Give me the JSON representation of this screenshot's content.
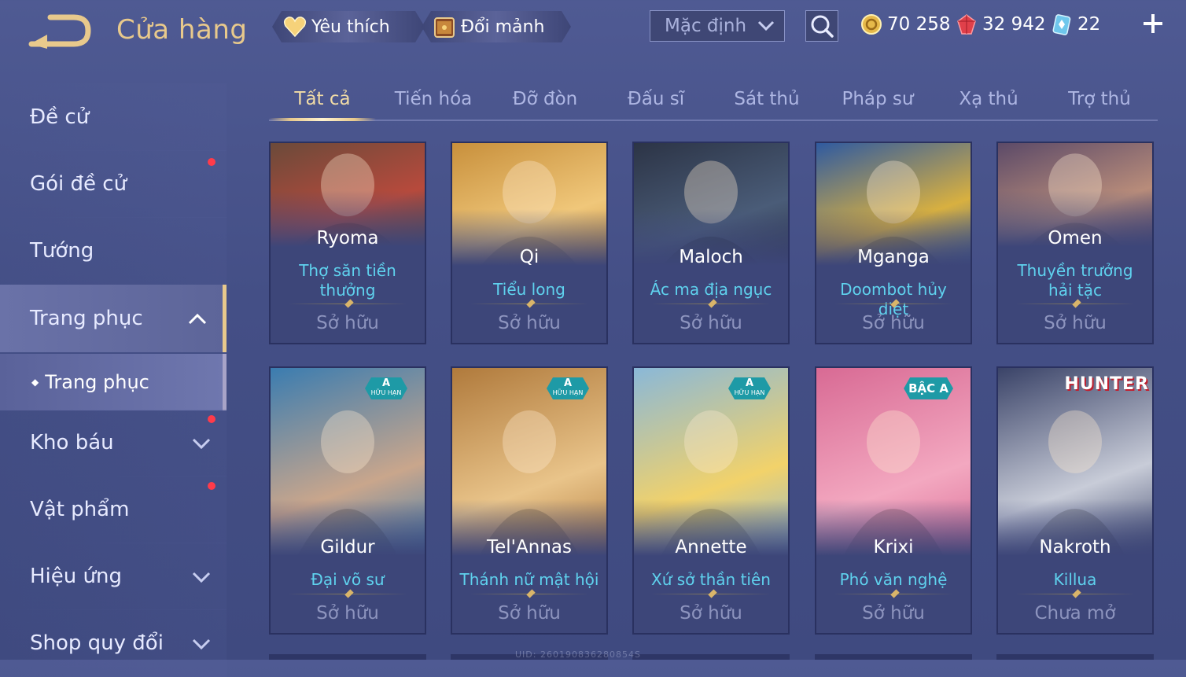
{
  "header": {
    "title": "Cửa hàng",
    "favorite_label": "Yêu thích",
    "exchange_label": "Đổi mảnh",
    "sort": {
      "selected": "Mặc định"
    },
    "currencies": [
      {
        "icon": "gold-coin-icon",
        "value": "70 258"
      },
      {
        "icon": "ruby-gem-icon",
        "value": "32 942"
      },
      {
        "icon": "diamond-card-icon",
        "value": "22"
      }
    ]
  },
  "sidebar": {
    "items": [
      {
        "label": "Đề cử"
      },
      {
        "label": "Gói đề cử"
      },
      {
        "label": "Tướng"
      },
      {
        "label": "Trang phục"
      },
      {
        "label": "Kho báu"
      },
      {
        "label": "Vật phẩm"
      },
      {
        "label": "Hiệu ứng"
      },
      {
        "label": "Shop quy đổi"
      }
    ],
    "sub_item": "Trang phục"
  },
  "tabs": [
    "Tất cả",
    "Tiến hóa",
    "Đỡ đòn",
    "Đấu sĩ",
    "Sát thủ",
    "Pháp sư",
    "Xạ thủ",
    "Trợ thủ"
  ],
  "cards": [
    {
      "name": "Ryoma",
      "skin": "Thợ săn tiền thưởng",
      "status": "Sở hữu",
      "badge": "",
      "colors": [
        "#6b4a3a",
        "#b74a3c"
      ]
    },
    {
      "name": "Qi",
      "skin": "Tiểu long",
      "status": "Sở hữu",
      "badge": "",
      "colors": [
        "#c8903c",
        "#f0c77a"
      ]
    },
    {
      "name": "Maloch",
      "skin": "Ác ma địa ngục",
      "status": "Sở hữu",
      "badge": "",
      "colors": [
        "#2c3446",
        "#4a5c78"
      ]
    },
    {
      "name": "Mganga",
      "skin": "Doombot hủy diệt",
      "status": "Sở hữu",
      "badge": "",
      "colors": [
        "#2f5aa0",
        "#d8b040"
      ]
    },
    {
      "name": "Omen",
      "skin": "Thuyền trưởng hải tặc",
      "status": "Sở hữu",
      "badge": "",
      "colors": [
        "#5c4a68",
        "#b88c7a"
      ]
    },
    {
      "name": "Gildur",
      "skin": "Đại võ sư",
      "status": "Sở hữu",
      "badge": "A|HỮU HẠN",
      "colors": [
        "#3a7cb0",
        "#c9a68c"
      ]
    },
    {
      "name": "Tel'Annas",
      "skin": "Thánh nữ mật hội",
      "status": "Sở hữu",
      "badge": "A|HỮU HẠN",
      "colors": [
        "#b07a3c",
        "#e9c48a"
      ]
    },
    {
      "name": "Annette",
      "skin": "Xứ sở thần tiên",
      "status": "Sở hữu",
      "badge": "A|HỮU HẠN",
      "colors": [
        "#8ab8d8",
        "#f2d26a"
      ]
    },
    {
      "name": "Krixi",
      "skin": "Phó văn nghệ",
      "status": "Sở hữu",
      "badge": "BẬC A",
      "colors": [
        "#d86a94",
        "#f3a8c0"
      ]
    },
    {
      "name": "Nakroth",
      "skin": "Killua",
      "status": "Chưa mở",
      "badge": "",
      "hunter": "HUNTER",
      "colors": [
        "#3a4368",
        "#c8ccd8"
      ]
    }
  ],
  "uid_watermark": "UID: 260190836280854S"
}
